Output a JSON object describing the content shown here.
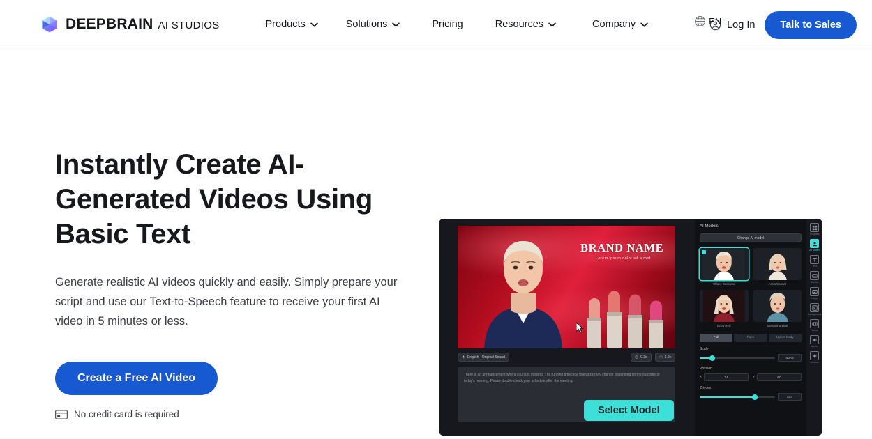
{
  "header": {
    "logo": {
      "icon": "cube-logo-icon",
      "name": "DEEPBRAIN",
      "sub": "AI STUDIOS"
    },
    "nav": [
      {
        "label": "Products",
        "has_menu": true
      },
      {
        "label": "Solutions",
        "has_menu": true
      },
      {
        "label": "Pricing",
        "has_menu": false
      },
      {
        "label": "Resources",
        "has_menu": true
      },
      {
        "label": "Company",
        "has_menu": true
      }
    ],
    "language": {
      "icon": "globe-icon",
      "label": "EN"
    },
    "login": {
      "icon": "user-circle-icon",
      "label": "Log In"
    },
    "cta": {
      "label": "Talk to Sales",
      "color": "#1659d1"
    }
  },
  "hero": {
    "headline": "Instantly Create AI-Generated Videos Using Basic Text",
    "subtext": "Generate realistic AI videos quickly and easily. Simply prepare your script and use our Text-to-Speech feature to receive your first AI video in 5 minutes or less.",
    "cta": {
      "label": "Create a Free AI Video",
      "color": "#1659d1"
    },
    "note": {
      "icon": "credit-card-icon",
      "label": "No credit card is required"
    }
  },
  "mockup": {
    "stage": {
      "brand_title": "BRAND NAME",
      "brand_subtitle": "Lorem ipsum dolor sit a met"
    },
    "toolbar": {
      "language_chip": {
        "icon": "mic-icon",
        "label": "English - Original Sound"
      },
      "duration_chip": {
        "icon": "clock-icon",
        "label": "0.3s"
      },
      "speed_chip": {
        "icon": "speed-icon",
        "label": "1.0x"
      }
    },
    "script_text": "There is an announcement where sound is missing. The running timecode tolerance may change depending on the outcome of today's meeting. Please double-check your schedule after the meeting.",
    "select_model_button": {
      "label": "Select Model",
      "color": "#3de0d8"
    },
    "panel": {
      "title": "AI Models",
      "change_button": "Change AI model",
      "models": [
        {
          "name": "Tiffany Business",
          "selected": true
        },
        {
          "name": "Anna Casual",
          "selected": false
        },
        {
          "name": "Erica Red",
          "selected": false
        },
        {
          "name": "Samantha Blue",
          "selected": false
        }
      ],
      "view_tabs": [
        {
          "label": "Full",
          "active": true
        },
        {
          "label": "Face",
          "active": false
        },
        {
          "label": "Upper body",
          "active": false
        }
      ],
      "scale": {
        "label": "Scale",
        "value": "40 %"
      },
      "position": {
        "label": "Position",
        "x_axis": "X",
        "x_value": "24",
        "y_axis": "Y",
        "y_value": "60"
      },
      "z_index": {
        "label": "Z index",
        "value": "404"
      }
    },
    "rail": [
      {
        "icon": "template-icon",
        "label": "Template",
        "active": false
      },
      {
        "icon": "ai-model-icon",
        "label": "AI Model",
        "active": true
      },
      {
        "icon": "text-icon",
        "label": "Text",
        "active": false
      },
      {
        "icon": "subtitle-icon",
        "label": "Subtitle",
        "active": false
      },
      {
        "icon": "image-icon",
        "label": "Image",
        "active": false
      },
      {
        "icon": "background-icon",
        "label": "Background",
        "active": false
      },
      {
        "icon": "frame-icon",
        "label": "Frame",
        "active": false
      },
      {
        "icon": "audio-icon",
        "label": "Audio",
        "active": false
      },
      {
        "icon": "ai-tools-icon",
        "label": "AI tools",
        "active": false
      }
    ]
  }
}
